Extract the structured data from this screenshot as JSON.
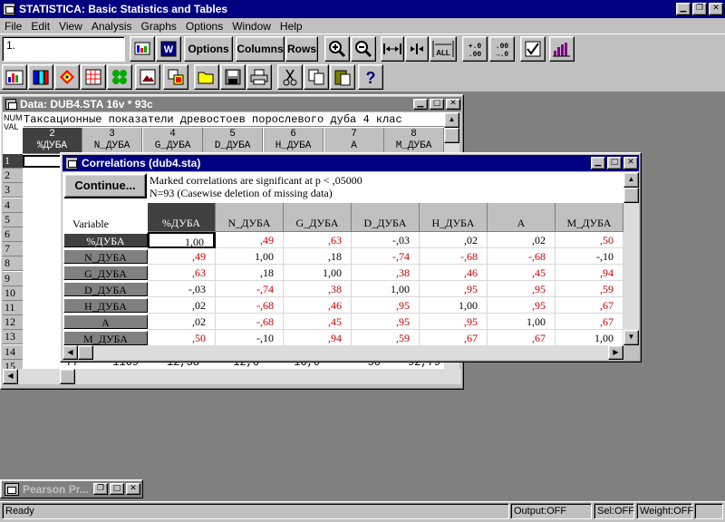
{
  "app": {
    "title": "STATISTICA: Basic Statistics and Tables"
  },
  "menu": [
    "File",
    "Edit",
    "View",
    "Analysis",
    "Graphs",
    "Options",
    "Window",
    "Help"
  ],
  "toolbar": {
    "case_field": "1.",
    "options_label": "Options",
    "columns_label": "Columns",
    "rows_label": "Rows"
  },
  "datawin": {
    "title": "Data: DUB4.STA 16v * 93c",
    "num_label": "NUM",
    "val_label": "VAL",
    "header_text": "Таксационные показатели древостоев порослевого дуба 4 клас",
    "columns": [
      {
        "num": "2",
        "name": "%ДУБА"
      },
      {
        "num": "3",
        "name": "N_ДУБА"
      },
      {
        "num": "4",
        "name": "G_ДУБА"
      },
      {
        "num": "5",
        "name": "D_ДУБА"
      },
      {
        "num": "6",
        "name": "H_ДУБА"
      },
      {
        "num": "7",
        "name": "A"
      },
      {
        "num": "8",
        "name": "M_ДУБА"
      }
    ],
    "row_numbers": [
      "1",
      "2",
      "3",
      "4",
      "5",
      "6",
      "7",
      "8",
      "9",
      "10",
      "11",
      "12",
      "13",
      "14",
      "15"
    ],
    "partial_row": [
      "77",
      "1169",
      "12,38",
      "12,6",
      "16,0",
      "50",
      "92,79"
    ]
  },
  "corr": {
    "title": "Correlations (dub4.sta)",
    "continue_label": "Continue...",
    "info_line1": "Marked correlations are significant at p < ,05000",
    "info_line2": "N=93 (Casewise deletion of missing data)",
    "variable_label": "Variable",
    "columns": [
      "%ДУБА",
      "N_ДУБА",
      "G_ДУБА",
      "D_ДУБА",
      "H_ДУБА",
      "A",
      "M_ДУБА"
    ],
    "rows": [
      {
        "name": "%ДУБА",
        "values": [
          "1,00",
          ",49",
          ",63",
          "-,03",
          ",02",
          ",02",
          ",50"
        ]
      },
      {
        "name": "N_ДУБА",
        "values": [
          ",49",
          "1,00",
          ",18",
          "-,74",
          "-,68",
          "-,68",
          "-,10"
        ]
      },
      {
        "name": "G_ДУБА",
        "values": [
          ",63",
          ",18",
          "1,00",
          ",38",
          ",46",
          ",45",
          ",94"
        ]
      },
      {
        "name": "D_ДУБА",
        "values": [
          "-,03",
          "-,74",
          ",38",
          "1,00",
          ",95",
          ",95",
          ",59"
        ]
      },
      {
        "name": "H_ДУБА",
        "values": [
          ",02",
          "-,68",
          ",46",
          ",95",
          "1,00",
          ",95",
          ",67"
        ]
      },
      {
        "name": "A",
        "values": [
          ",02",
          "-,68",
          ",45",
          ",95",
          ",95",
          "1,00",
          ",67"
        ]
      },
      {
        "name": "M_ДУБА",
        "values": [
          ",50",
          "-,10",
          ",94",
          ",59",
          ",67",
          ",67",
          "1,00"
        ]
      }
    ],
    "significant": [
      [
        0,
        1,
        1,
        0,
        0,
        0,
        1
      ],
      [
        1,
        0,
        0,
        1,
        1,
        1,
        0
      ],
      [
        1,
        0,
        0,
        1,
        1,
        1,
        1
      ],
      [
        0,
        1,
        1,
        0,
        1,
        1,
        1
      ],
      [
        0,
        1,
        1,
        1,
        0,
        1,
        1
      ],
      [
        0,
        1,
        1,
        1,
        1,
        0,
        1
      ],
      [
        1,
        0,
        1,
        1,
        1,
        1,
        0
      ]
    ],
    "significant_color": "#c00000"
  },
  "minimized": {
    "title": "Pearson Pr..."
  },
  "status": {
    "ready": "Ready",
    "output": "Output:OFF",
    "sel": "Sel:OFF",
    "weight": "Weight:OFF"
  }
}
